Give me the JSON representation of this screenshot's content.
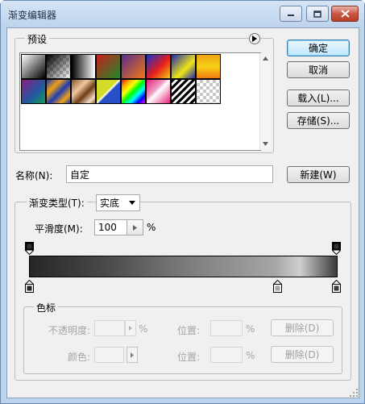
{
  "window": {
    "title": "渐变编辑器"
  },
  "buttons": {
    "ok": "确定",
    "cancel": "取消",
    "load": "载入(L)...",
    "save": "存储(S)...",
    "new": "新建(W)"
  },
  "presets": {
    "label": "预设"
  },
  "name": {
    "label": "名称(N):",
    "value": "自定"
  },
  "gradient_type": {
    "label": "渐变类型(T):",
    "value": "实底"
  },
  "smoothness": {
    "label": "平滑度(M):",
    "value": "100",
    "unit": "%"
  },
  "color_stops": {
    "group_label": "色标",
    "opacity_label": "不透明度:",
    "opacity_unit": "%",
    "location_label": "位置:",
    "location_unit": "%",
    "delete_label": "删除(D)",
    "color_label": "颜色:"
  },
  "colors": {
    "gradient_start": "#262626",
    "gradient_mid": "#a6a6a6",
    "gradient_end": "#3a3a3a",
    "accent": "#3c7fb1"
  }
}
